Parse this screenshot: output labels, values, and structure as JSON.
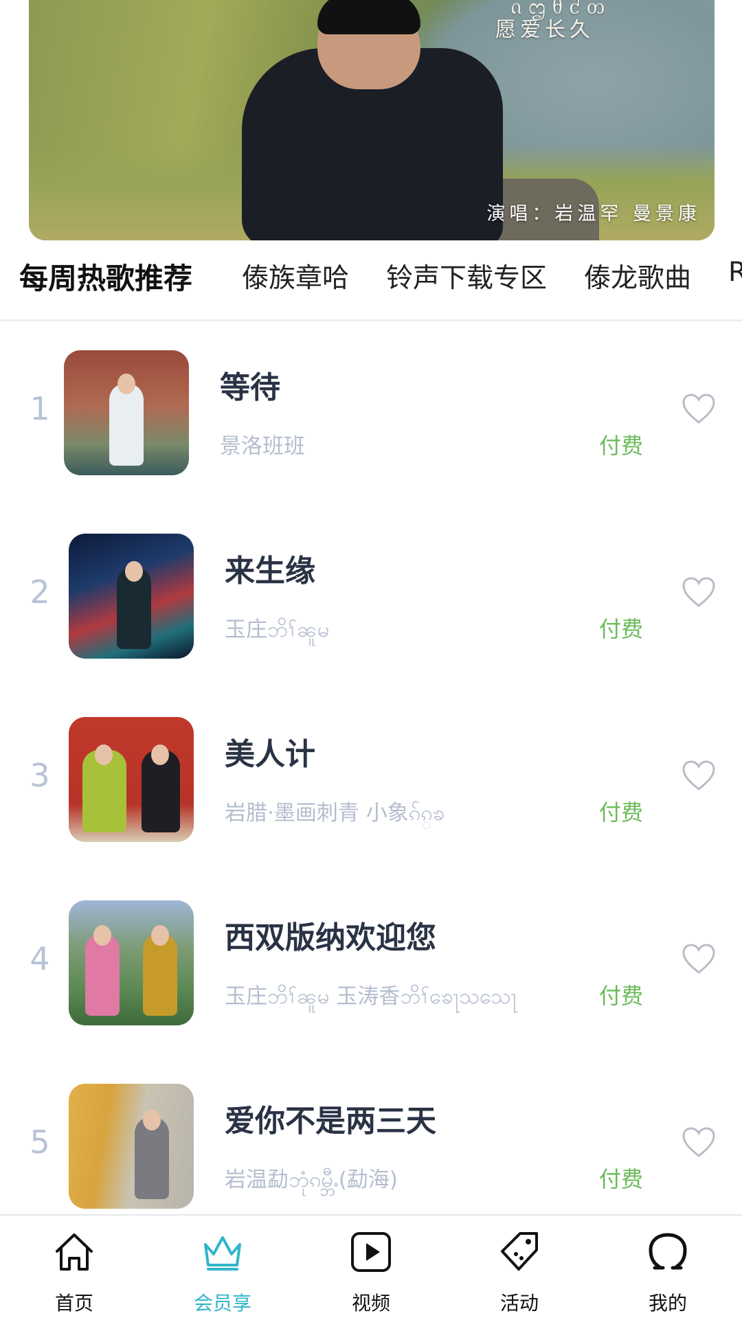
{
  "banner": {
    "script_title": "ᦵᦗᦲᦺᦎ",
    "subtitle": "愿爱长久",
    "singer": "演唱：岩温罕  曼景康"
  },
  "tabs": [
    {
      "label": "每周热歌推荐",
      "active": true
    },
    {
      "label": "傣族章哈",
      "active": false
    },
    {
      "label": "铃声下载专区",
      "active": false
    },
    {
      "label": "傣龙歌曲",
      "active": false
    },
    {
      "label": "R",
      "active": false
    }
  ],
  "songs": [
    {
      "rank": "1",
      "title": "等待",
      "artist": "景洛班班",
      "price": "付费"
    },
    {
      "rank": "2",
      "title": "来生缘",
      "artist": "玉庄ဘိၢ်ၼူမ",
      "price": "付费"
    },
    {
      "rank": "3",
      "title": "美人计",
      "artist": "岩腊·墨画刺青   小象ၵ်ၵ္ၶ",
      "price": "付费"
    },
    {
      "rank": "4",
      "title": "西双版纳欢迎您",
      "artist": "玉庄ဘိၢ်ၼူမ   玉涛香ဘိၢ်ၶေႃသသေႃ",
      "price": "付费"
    },
    {
      "rank": "5",
      "title": "爱你不是两三天",
      "artist": "岩温勐ဘုံၵမ္ဘီႉ(勐海)",
      "price": "付费"
    }
  ],
  "nav": [
    {
      "label": "首页",
      "icon": "home-icon",
      "active": false
    },
    {
      "label": "会员享",
      "icon": "crown-icon",
      "active": true
    },
    {
      "label": "视频",
      "icon": "play-icon",
      "active": false
    },
    {
      "label": "活动",
      "icon": "tag-icon",
      "active": false
    },
    {
      "label": "我的",
      "icon": "profile-icon",
      "active": false
    }
  ],
  "colors": {
    "accent": "#2fb5c9",
    "paid": "#6bbb5a",
    "rank": "#b8c2d6",
    "title": "#2a3345",
    "artist": "#b4bdcf"
  }
}
